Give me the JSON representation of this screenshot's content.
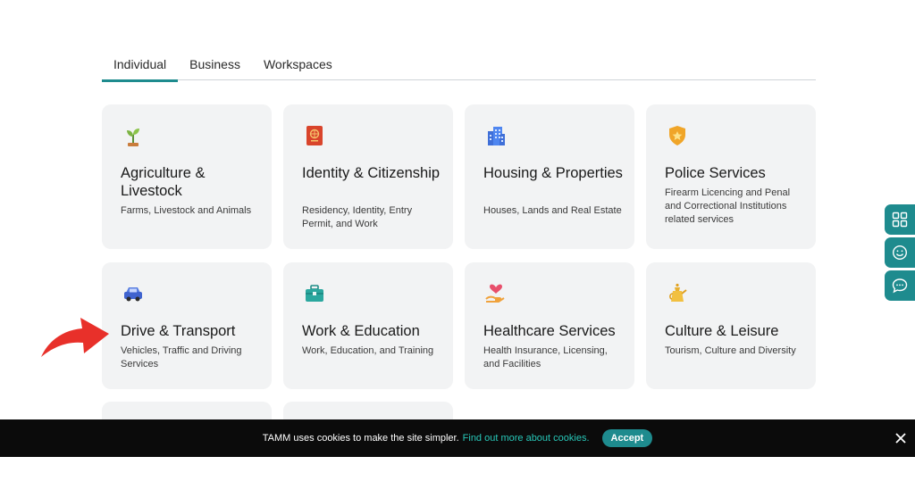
{
  "tabs": [
    {
      "label": "Individual",
      "active": true
    },
    {
      "label": "Business",
      "active": false
    },
    {
      "label": "Workspaces",
      "active": false
    }
  ],
  "cards": [
    {
      "title": "Agriculture & Livestock",
      "desc": "Farms, Livestock and Animals",
      "icon": "sprout-icon"
    },
    {
      "title": "Identity & Citizenship",
      "desc": "Residency, Identity, Entry Permit, and Work",
      "icon": "passport-icon"
    },
    {
      "title": "Housing & Properties",
      "desc": "Houses, Lands and Real Estate",
      "icon": "building-icon"
    },
    {
      "title": "Police Services",
      "desc": "Firearm Licencing and Penal and Correctional Institutions related services",
      "icon": "police-badge-icon"
    },
    {
      "title": "Drive & Transport",
      "desc": "Vehicles, Traffic and Driving Services",
      "icon": "car-icon"
    },
    {
      "title": "Work & Education",
      "desc": "Work, Education, and Training",
      "icon": "briefcase-icon"
    },
    {
      "title": "Healthcare Services",
      "desc": "Health Insurance, Licensing, and Facilities",
      "icon": "heart-hand-icon"
    },
    {
      "title": "Culture & Leisure",
      "desc": "Tourism, Culture and Diversity",
      "icon": "dallah-icon"
    }
  ],
  "side_buttons": [
    "grid-icon",
    "smiley-icon",
    "chat-icon"
  ],
  "cookie": {
    "message": "TAMM uses cookies to make the site simpler.",
    "link": "Find out more about cookies.",
    "accept": "Accept"
  },
  "colors": {
    "accent": "#1e8b8e",
    "link": "#28c7b8",
    "card_bg": "#f2f3f4",
    "arrow": "#e8302a"
  }
}
